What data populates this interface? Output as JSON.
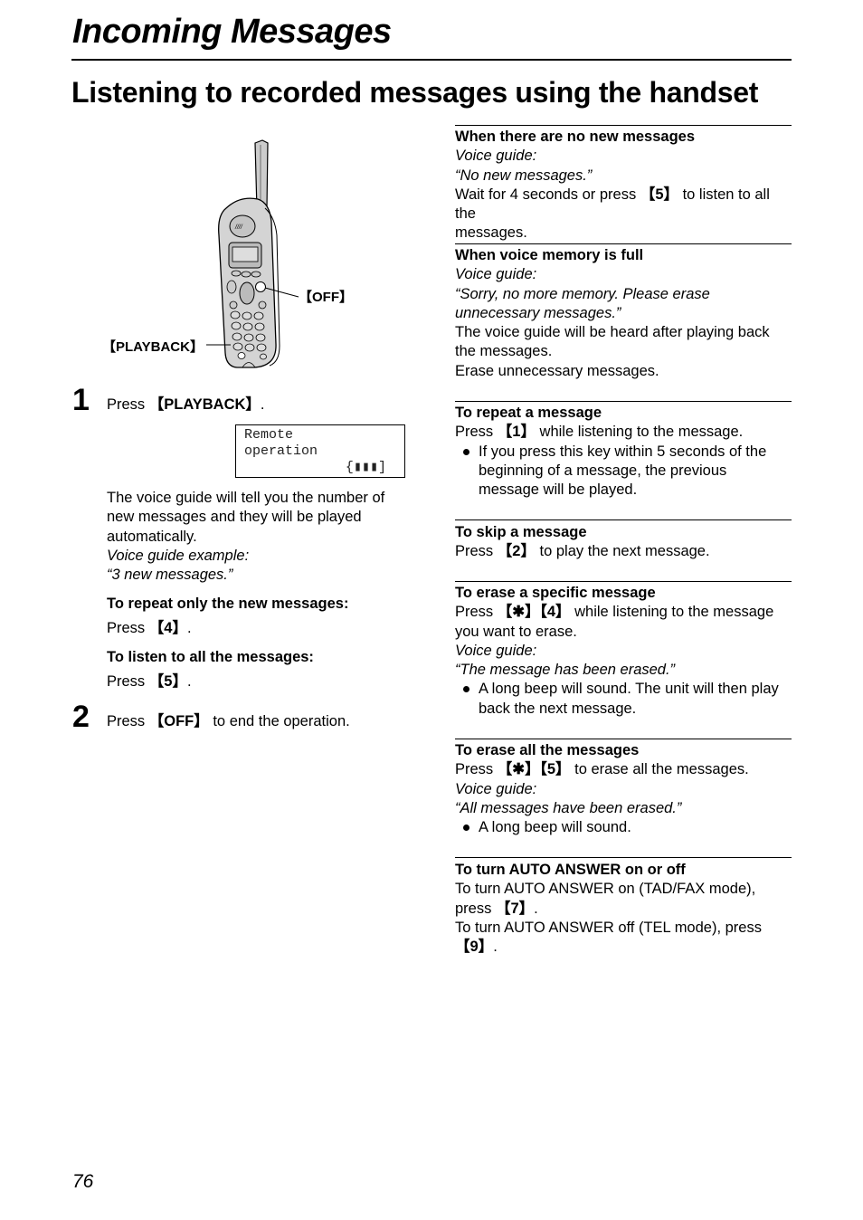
{
  "header": {
    "section_title": "Incoming Messages",
    "page_heading": "Listening to recorded messages using the handset"
  },
  "figure": {
    "device": "cordless-handset",
    "callouts": {
      "off": "【OFF】",
      "playback": "【PLAYBACK】"
    }
  },
  "steps": [
    {
      "number": "1",
      "text_prefix": "Press ",
      "key": "【PLAYBACK】",
      "text_suffix": ".",
      "display": {
        "line1": "Remote",
        "line2": "operation",
        "line3": "{▮▮▮]"
      },
      "description": [
        "The voice guide will tell you the number of",
        "new messages and they will be played",
        "automatically."
      ],
      "voice_guide_label": "Voice guide example:",
      "voice_guide_quote": "“3 new messages.”",
      "sub_options": [
        {
          "heading": "To repeat only the new messages:",
          "prefix": "Press ",
          "key": "【4】",
          "suffix": "."
        },
        {
          "heading": "To listen to all the messages:",
          "prefix": "Press ",
          "key": "【5】",
          "suffix": "."
        }
      ]
    },
    {
      "number": "2",
      "text_prefix": "Press ",
      "key": "【OFF】",
      "text_suffix": " to end the operation."
    }
  ],
  "sections": {
    "no_new": {
      "heading": "When there are no new messages",
      "voice_label": "Voice guide:",
      "voice_quote": "“No new messages.”",
      "body_prefix": "Wait for 4 seconds or press ",
      "key": "【5】",
      "body_suffix": " to listen to all the",
      "body_line2": "messages."
    },
    "memory_full": {
      "heading": "When voice memory is full",
      "voice_label": "Voice guide:",
      "voice_quote_1": "“Sorry, no more memory. Please erase",
      "voice_quote_2": "unnecessary messages.”",
      "body_1": "The voice guide will be heard after playing back",
      "body_2": "the messages.",
      "body_3": "Erase unnecessary messages."
    },
    "repeat": {
      "heading": "To repeat a message",
      "prefix": "Press ",
      "key": "【1】",
      "suffix": " while listening to the message.",
      "bullet_1": "If you press this key within 5 seconds of the",
      "bullet_2": "beginning of a message, the previous",
      "bullet_3": "message will be played."
    },
    "skip": {
      "heading": "To skip a message",
      "prefix": "Press ",
      "key": "【2】",
      "suffix": " to play the next message."
    },
    "erase_specific": {
      "heading": "To erase a specific message",
      "prefix": "Press ",
      "key": "【✱】【4】",
      "suffix": " while listening to the message",
      "line2": "you want to erase.",
      "voice_label": "Voice guide:",
      "voice_quote": "“The message has been erased.”",
      "bullet_1": "A long beep will sound. The unit will then play",
      "bullet_2": "back the next message."
    },
    "erase_all": {
      "heading": "To erase all the messages",
      "prefix": "Press ",
      "key": "【✱】【5】",
      "suffix": " to erase all the messages.",
      "voice_label": "Voice guide:",
      "voice_quote": "“All messages have been erased.”",
      "bullet_1": "A long beep will sound."
    },
    "auto_answer": {
      "heading": "To turn AUTO ANSWER on or off",
      "on_line1": "To turn AUTO ANSWER on (TAD/FAX mode),",
      "on_prefix": "press ",
      "on_key": "【7】",
      "on_suffix": ".",
      "off_line1": "To turn AUTO ANSWER off (TEL mode), press",
      "off_key": "【9】",
      "off_suffix": "."
    }
  },
  "footer": {
    "page_number": "76"
  }
}
